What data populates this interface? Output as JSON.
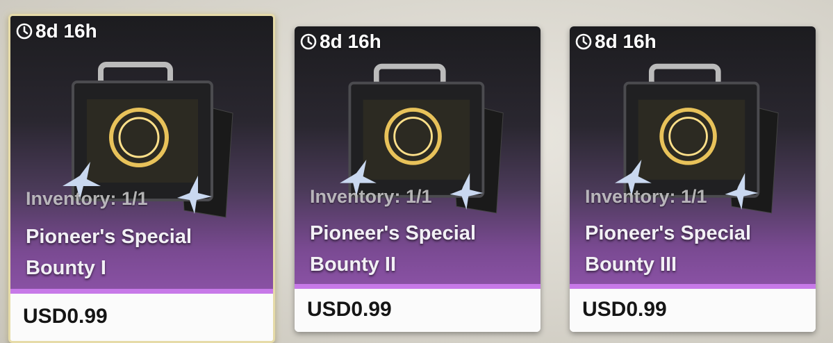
{
  "cards": [
    {
      "timer": "8d 16h",
      "inventory": "Inventory: 1/1",
      "name_line1": "Pioneer's Special",
      "name_line2": "Bounty I",
      "price": "USD0.99",
      "selected": true
    },
    {
      "timer": "8d 16h",
      "inventory": "Inventory: 1/1",
      "name_line1": "Pioneer's Special",
      "name_line2": "Bounty II",
      "price": "USD0.99",
      "selected": false
    },
    {
      "timer": "8d 16h",
      "inventory": "Inventory: 1/1",
      "name_line1": "Pioneer's Special",
      "name_line2": "Bounty III",
      "price": "USD0.99",
      "selected": false
    }
  ],
  "colors": {
    "accent_stripe": "#c779e8",
    "selected_border": "#e6dba8",
    "card_gradient_bottom": "#8b52a6"
  },
  "icons": {
    "timer": "clock-icon",
    "artwork": "briefcase-icon",
    "decoration": "star-crystal-icon"
  }
}
